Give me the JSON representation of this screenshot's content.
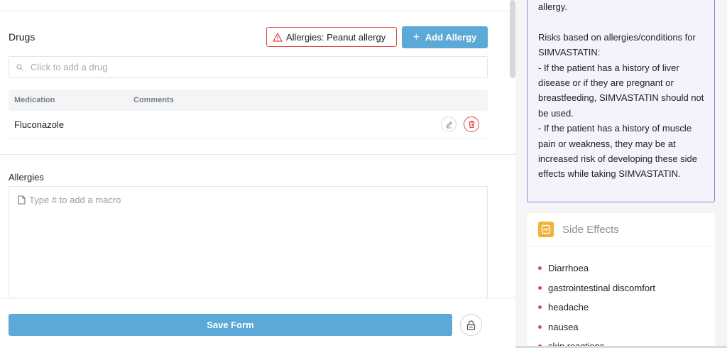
{
  "drugs": {
    "title": "Drugs",
    "allergy_badge": "Allergies: Peanut allergy",
    "add_allergy_label": "Add Allergy",
    "search_placeholder": "Click to add a drug",
    "columns": [
      "Medication",
      "Comments"
    ],
    "rows": [
      {
        "medication": "Fluconazole",
        "comments": ""
      }
    ]
  },
  "allergies": {
    "title": "Allergies",
    "macro_placeholder": "Type # to add a macro"
  },
  "footer": {
    "save_label": "Save Form"
  },
  "warning": {
    "text": "allergy.\n\nRisks based on allergies/conditions for SIMVASTATIN:\n- If the patient has a history of liver disease or if they are pregnant or breastfeeding, SIMVASTATIN should not be used.\n- If the patient has a history of muscle pain or weakness, they may be at increased risk of developing these side effects while taking SIMVASTATIN."
  },
  "side_effects": {
    "title": "Side Effects",
    "items": [
      "Diarrhoea",
      "gastrointestinal discomfort",
      "headache",
      "nausea",
      "skin reactions"
    ]
  },
  "icons": {
    "badge": "warning-triangle-icon",
    "add": "plus-icon",
    "search": "search-icon",
    "edit": "pencil-icon",
    "delete": "trash-icon",
    "macro": "document-icon",
    "lock": "lock-icon",
    "side_effects": "chart-icon"
  },
  "colors": {
    "primary": "#5aa9d6",
    "danger": "#e04b4b",
    "warning_border": "#9a7fd8",
    "warning_bg": "#f5f1fd",
    "side_effects_icon": "#f2b23a"
  }
}
